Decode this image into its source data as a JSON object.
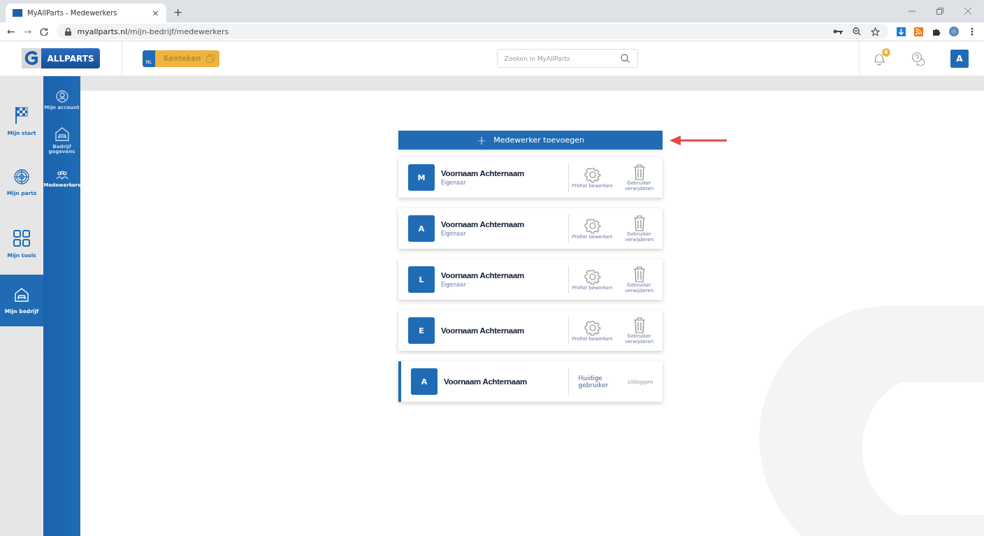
{
  "browser": {
    "tab_title": "MyAllParts - Medewerkers",
    "tab_close": "×",
    "new_tab": "+",
    "url_host": "myallparts.nl",
    "url_path": "/mijn-bedrijf/medewerkers",
    "nav": [
      "←",
      "→"
    ],
    "menu": "⋮"
  },
  "header": {
    "logo_text": "ALLPARTS",
    "plate_country": "NL",
    "plate_label": "Kenteken",
    "search": {
      "placeholder": "Zoeken in MyAllParts"
    },
    "notification_count": "6",
    "avatar": "A"
  },
  "main_nav": [
    {
      "label": "Mijn start",
      "kind": "flag",
      "selected": false
    },
    {
      "label": "Mijn parts",
      "kind": "disc",
      "selected": false
    },
    {
      "label": "Mijn tools",
      "kind": "grid",
      "selected": false
    },
    {
      "label": "Mijn bedrijf",
      "kind": "garage",
      "selected": true
    }
  ],
  "sub_nav": [
    {
      "label": "Mijn account",
      "kind": "user",
      "selected": false
    },
    {
      "label": "Bedrijf gegevens",
      "kind": "garage",
      "selected": false
    },
    {
      "label": "Medewerkers",
      "kind": "people",
      "selected": true
    }
  ],
  "add_button": {
    "icon": "+",
    "label": "Medewerker toevoegen"
  },
  "employees": [
    {
      "initial": "M",
      "name": "Voornaam Achternaam",
      "role": "Eigenaar",
      "current": false,
      "actions": [
        "Profiel bewerken",
        "Gebruiker verwijderen"
      ]
    },
    {
      "initial": "A",
      "name": "Voornaam Achternaam",
      "role": "Eigenaar",
      "current": false,
      "actions": [
        "Profiel bewerken",
        "Gebruiker verwijderen"
      ]
    },
    {
      "initial": "L",
      "name": "Voornaam Achternaam",
      "role": "Eigenaar",
      "current": false,
      "actions": [
        "Profiel bewerken",
        "Gebruiker verwijderen"
      ]
    },
    {
      "initial": "E",
      "name": "Voornaam Achternaam",
      "current": false,
      "actions": [
        "Profiel bewerken",
        "Gebruiker verwijderen"
      ]
    },
    {
      "initial": "A",
      "name": "Voornaam Achternaam",
      "current": true,
      "status": "Huidige gebruiker",
      "logout": "Uitloggen"
    }
  ]
}
